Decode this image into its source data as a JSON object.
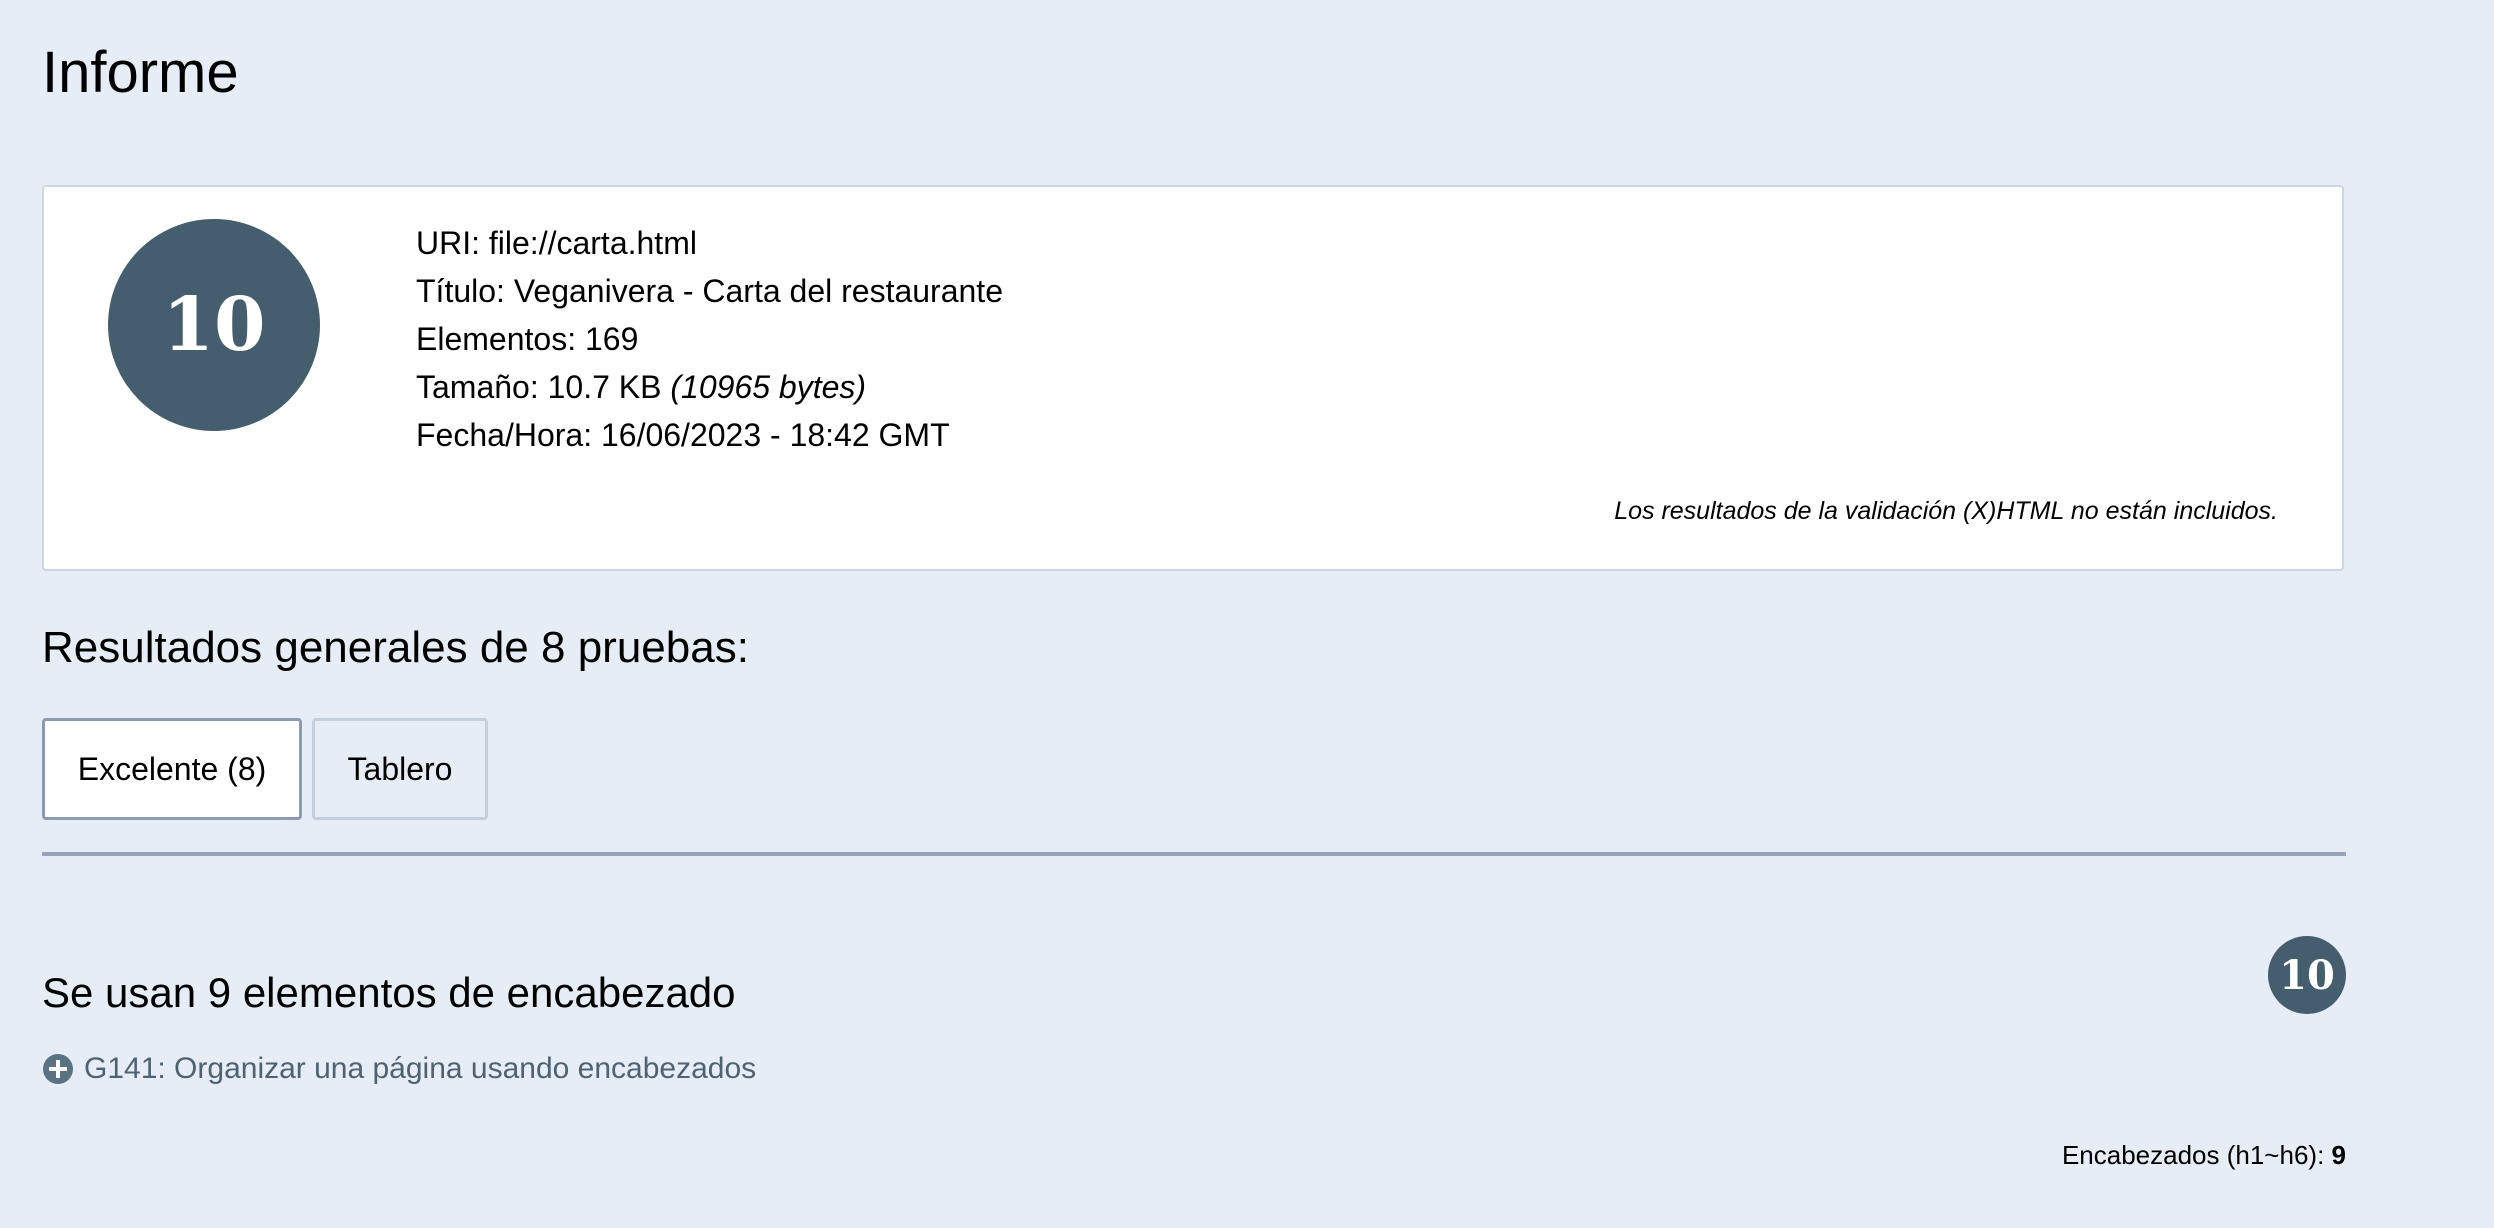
{
  "page": {
    "title": "Informe"
  },
  "summary": {
    "score": "10",
    "uri_label": "URI:",
    "uri_value": "file://carta.html",
    "title_label": "Título:",
    "title_value": "Veganivera - Carta del restaurante",
    "elements_label": "Elementos:",
    "elements_value": "169",
    "size_label": "Tamaño:",
    "size_value": "10.7 KB",
    "size_bytes": "(10965 bytes)",
    "datetime_label": "Fecha/Hora:",
    "datetime_value": "16/06/2023 - 18:42 GMT",
    "validation_note": "Los resultados de la validación (X)HTML no están incluidos."
  },
  "results": {
    "heading": "Resultados generales de 8 pruebas:",
    "tabs": [
      {
        "label": "Excelente (8)",
        "active": true
      },
      {
        "label": "Tablero",
        "active": false
      }
    ]
  },
  "result_item": {
    "title": "Se usan 9 elementos de encabezado",
    "score": "10",
    "technique_icon": "plus-circle-icon",
    "technique_label": "G141: Organizar una página usando encabezados",
    "count_label": "Encabezados (h1~h6):",
    "count_value": "9"
  },
  "colors": {
    "background": "#e6edf6",
    "score_badge": "#445e6e",
    "link_text": "#4e6272"
  }
}
